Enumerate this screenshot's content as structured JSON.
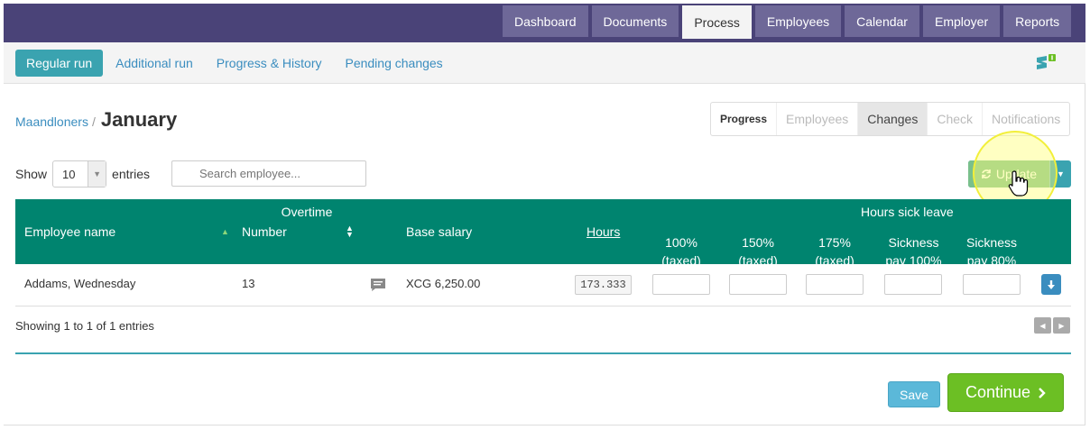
{
  "top_nav": {
    "tabs": [
      {
        "label": "Dashboard",
        "active": false
      },
      {
        "label": "Documents",
        "active": false
      },
      {
        "label": "Process",
        "active": true
      },
      {
        "label": "Employees",
        "active": false
      },
      {
        "label": "Calendar",
        "active": false
      },
      {
        "label": "Employer",
        "active": false
      },
      {
        "label": "Reports",
        "active": false
      }
    ]
  },
  "sub_nav": {
    "items": [
      {
        "label": "Regular run",
        "active": true
      },
      {
        "label": "Additional run",
        "active": false
      },
      {
        "label": "Progress & History",
        "active": false
      },
      {
        "label": "Pending changes",
        "active": false
      }
    ],
    "help_icon": "chat-help-icon"
  },
  "breadcrumb": {
    "parent": "Maandloners",
    "separator": "/",
    "title": "January"
  },
  "steps": [
    {
      "label": "Progress",
      "state": "current"
    },
    {
      "label": "Employees",
      "state": "disabled"
    },
    {
      "label": "Changes",
      "state": "done"
    },
    {
      "label": "Check",
      "state": "disabled"
    },
    {
      "label": "Notifications",
      "state": "disabled"
    }
  ],
  "table_controls": {
    "show_label": "Show",
    "entries_value": "10",
    "entries_label": "entries",
    "search_placeholder": "Search employee..."
  },
  "update_button": {
    "label": "Update"
  },
  "table": {
    "group_headers": {
      "overtime": "Overtime",
      "sick": "Hours sick leave"
    },
    "columns": {
      "name": "Employee name",
      "number": "Number",
      "base_salary": "Base salary",
      "hours": "Hours",
      "ot100": [
        "100%",
        "(taxed)"
      ],
      "ot150": [
        "150%",
        "(taxed)"
      ],
      "ot175": [
        "175%",
        "(taxed)"
      ],
      "sick100": [
        "Sickness",
        "pay 100%"
      ],
      "sick80": [
        "Sickness",
        "pay 80%"
      ]
    },
    "rows": [
      {
        "name": "Addams, Wednesday",
        "number": "13",
        "base_salary": "XCG 6,250.00",
        "hours": "173.333"
      }
    ]
  },
  "footer": {
    "info": "Showing 1 to 1 of 1 entries"
  },
  "actions": {
    "save": "Save",
    "continue": "Continue"
  },
  "colors": {
    "topbar": "#4a4378",
    "table_header": "#00846f",
    "accent": "#3aa3b0",
    "continue": "#6cbf24"
  }
}
